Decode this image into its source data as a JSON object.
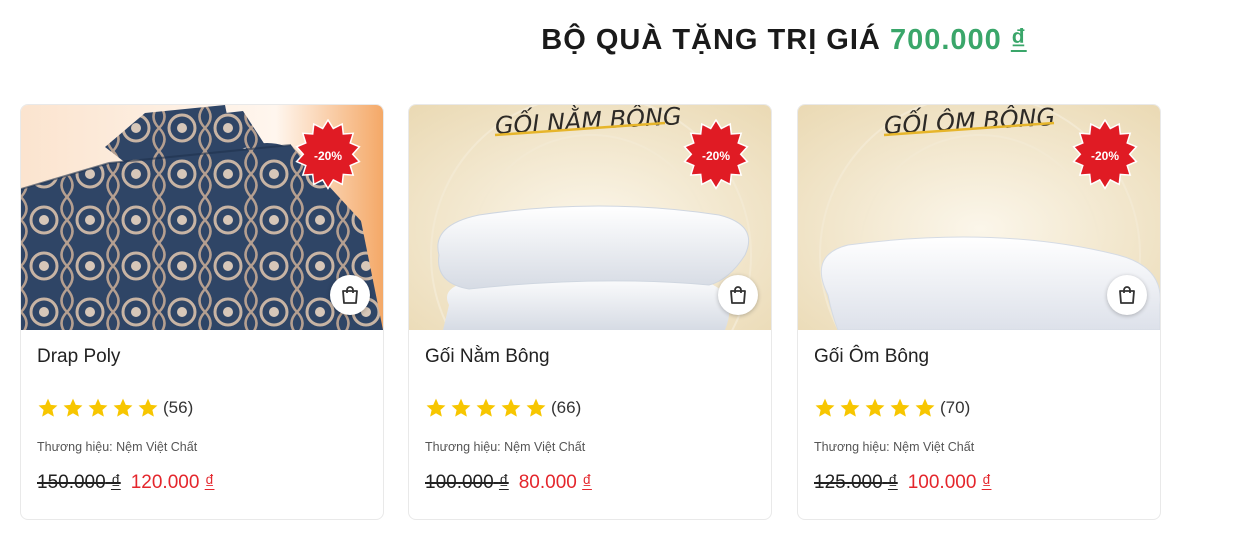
{
  "heading": {
    "prefix": "BỘ QUÀ TẶNG TRỊ GIÁ",
    "amount": "700.000",
    "currency": "₫"
  },
  "colors": {
    "accent_green": "#3aa66a",
    "sale_red": "#e4262c",
    "badge_red": "#e01b24",
    "star_yellow": "#f7c600"
  },
  "icons": {
    "cart": "shopping-bag-icon",
    "star": "star-icon",
    "badge": "discount-burst-badge"
  },
  "products": [
    {
      "image_caption": "",
      "name": "Drap Poly",
      "discount": "-20%",
      "rating_stars": 5,
      "review_count": "(56)",
      "brand": "Thương hiệu: Nệm Việt Chất",
      "old_price": "150.000",
      "new_price": "120.000",
      "currency": "₫"
    },
    {
      "image_caption": "GỐI NẰM BÔNG",
      "name": "Gối Nằm Bông",
      "discount": "-20%",
      "rating_stars": 5,
      "review_count": "(66)",
      "brand": "Thương hiệu: Nệm Việt Chất",
      "old_price": "100.000",
      "new_price": "80.000",
      "currency": "₫"
    },
    {
      "image_caption": "GỐI ÔM BÔNG",
      "name": "Gối Ôm Bông",
      "discount": "-20%",
      "rating_stars": 5,
      "review_count": "(70)",
      "brand": "Thương hiệu: Nệm Việt Chất",
      "old_price": "125.000",
      "new_price": "100.000",
      "currency": "₫"
    }
  ]
}
